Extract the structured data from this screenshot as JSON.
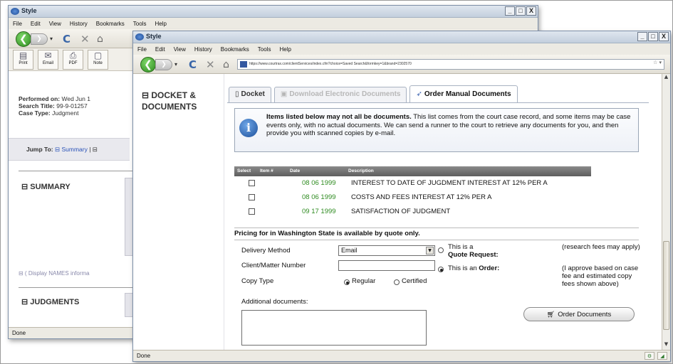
{
  "back_window": {
    "title": "Style",
    "controls": [
      "_",
      "□",
      "X"
    ],
    "menu": [
      "File",
      "Edit",
      "View",
      "History",
      "Bookmarks",
      "Tools",
      "Help"
    ],
    "print_buttons": [
      "Print",
      "Email",
      "PDF",
      "Note"
    ],
    "performed_label": "Performed on:",
    "performed_value": "Wed Jun 1",
    "search_title_label": "Search Title:",
    "search_title_value": "99-9-01257",
    "case_type_label": "Case Type:",
    "case_type_value": "Judgment",
    "jump_to_label": "Jump To:",
    "jump_to_link": "⊟ Summary",
    "jump_sep": "| ⊟",
    "summary_heading": "⊟ SUMMARY",
    "display_names": "⊟ ( Display NAMES informa",
    "judgments_heading": "⊟ JUDGMENTS",
    "status": "Done"
  },
  "front_window": {
    "title": "Style",
    "controls": [
      "_",
      "□",
      "X"
    ],
    "menu": [
      "File",
      "Edit",
      "View",
      "History",
      "Bookmarks",
      "Tools",
      "Help"
    ],
    "url": "https://www.courtrax.com/clientServices/index.cfm?choice=Saved Search&formkey=1&brand=2302570",
    "section_heading_line1": "⊟ DOCKET &",
    "section_heading_line2": "DOCUMENTS",
    "tabs": [
      {
        "label": "Docket",
        "state": "normal"
      },
      {
        "label": "Download Electronic Documents",
        "state": "disabled"
      },
      {
        "label": "Order Manual Documents",
        "state": "active"
      }
    ],
    "info_bold": "Items listed below may not all be documents.",
    "info_rest": " This list comes from the court case record, and some items may be case events only, with no actual documents. We can send a runner to the court to retrieve any documents for you, and then provide you with scanned copies by e-mail.",
    "table": {
      "headers": [
        "Select",
        "Item #",
        "Date",
        "Description"
      ],
      "rows": [
        {
          "date": "08 06 1999",
          "description": "INTEREST TO DATE OF JUGDMENT INTEREST AT 12% PER A"
        },
        {
          "date": "08 06 1999",
          "description": "COSTS AND FEES INTEREST AT 12% PER A"
        },
        {
          "date": "09 17 1999",
          "description": "SATISFACTION OF JUDGMENT"
        }
      ]
    },
    "pricing": "Pricing for in Washington State is available by quote only.",
    "form": {
      "delivery_label": "Delivery Method",
      "delivery_value": "Email",
      "client_label": "Client/Matter Number",
      "copy_label": "Copy Type",
      "copy_regular": "Regular",
      "copy_certified": "Certified",
      "additional_label": "Additional documents:",
      "quote_line1": "This is a",
      "quote_line2": "Quote Request:",
      "quote_note": "(research fees may apply)",
      "order_line1": "This is an",
      "order_bold": "Order:",
      "order_note": "(I approve based on case fee and estimated copy fees shown above)",
      "order_button": "Order Documents"
    },
    "status": "Done"
  }
}
